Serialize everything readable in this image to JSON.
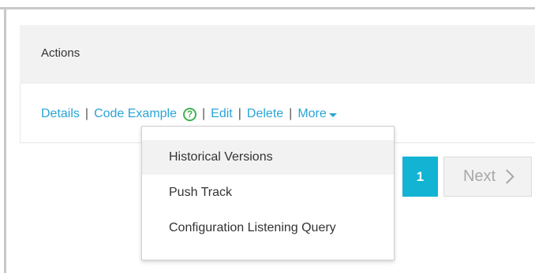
{
  "table": {
    "header": "Actions",
    "row_actions": {
      "details": "Details",
      "code_example": "Code Example",
      "help_glyph": "?",
      "edit": "Edit",
      "delete": "Delete",
      "more": "More",
      "separator": "|"
    }
  },
  "dropdown": {
    "items": [
      {
        "label": "Historical Versions",
        "highlighted": true
      },
      {
        "label": "Push Track",
        "highlighted": false
      },
      {
        "label": "Configuration Listening Query",
        "highlighted": false
      }
    ]
  },
  "pagination": {
    "current_page": "1",
    "next_label": "Next"
  },
  "colors": {
    "link": "#2aa4d5",
    "help_icon": "#3fb34f",
    "pager_active": "#12b3d3"
  }
}
